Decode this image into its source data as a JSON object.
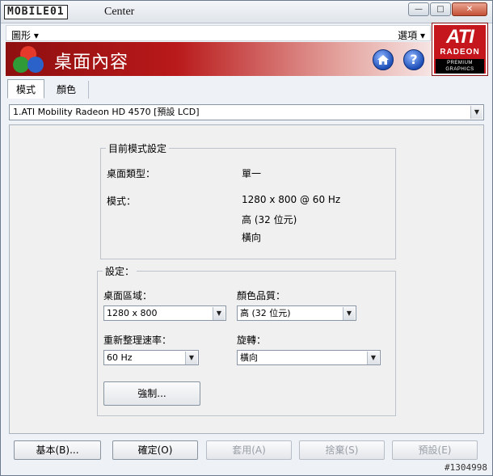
{
  "window": {
    "title_logo": "MOBILE01",
    "title": "Center",
    "buttons": {
      "minimize": "—",
      "maximize": "□",
      "close": "✕"
    }
  },
  "menu": {
    "left": "圖形 ▾",
    "right": "選項 ▾"
  },
  "brand": {
    "ati": "ATI",
    "radeon": "RADEON",
    "premium": "PREMIUM GRAPHICS"
  },
  "banner": {
    "title": "桌面內容"
  },
  "tabs": [
    {
      "label": "模式",
      "active": true
    },
    {
      "label": "顏色",
      "active": false
    }
  ],
  "device": {
    "selected": "1.ATI Mobility Radeon HD 4570 [預設 LCD]"
  },
  "current_mode": {
    "legend": "目前模式設定",
    "desktop_type_label": "桌面類型：",
    "desktop_type_value": "單一",
    "mode_label": "模式：",
    "mode_resolution": "1280 x 800 @ 60 Hz",
    "mode_color": "高 (32 位元)",
    "mode_orientation": "橫向"
  },
  "settings": {
    "legend": "設定：",
    "desktop_area_label": "桌面區域：",
    "desktop_area_value": "1280 x 800",
    "color_quality_label": "顏色品質：",
    "color_quality_value": "高 (32 位元)",
    "refresh_label": "重新整理速率：",
    "refresh_value": "60 Hz",
    "rotation_label": "旋轉：",
    "rotation_value": "橫向",
    "force_button": "強制..."
  },
  "footer": {
    "basic": "基本(B)...",
    "ok": "確定(O)",
    "apply": "套用(A)",
    "discard": "捨棄(S)",
    "defaults": "預設(E)"
  },
  "watermark": "#1304998",
  "colors": {
    "accent_red": "#c4161c",
    "banner_dark": "#8e0f10"
  }
}
